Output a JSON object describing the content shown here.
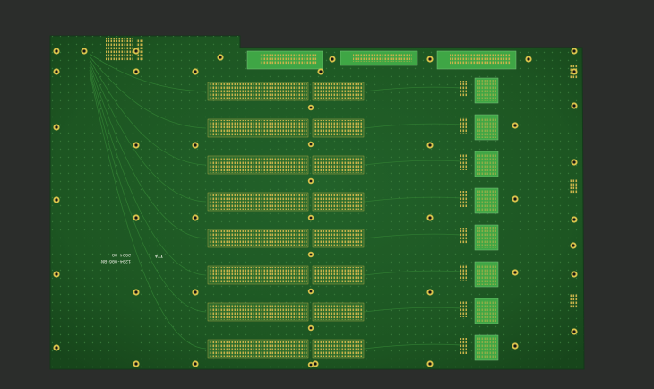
{
  "board": {
    "description_colors": {
      "background": "#2b2d2b",
      "solder_mask": "#1f5a23",
      "solder_mask_dark": "#184a1c",
      "copper_pad": "#c8b24a",
      "trace": "#2f7a31",
      "mounting_hole_ring": "#d9c24c",
      "silkscreen": "#e8ecdf",
      "green_connector": "#3fa645"
    },
    "silkscreen": {
      "line1": "1204-006-BN",
      "line2": "2024 08",
      "logo_mark": "IIA"
    },
    "slot_count": 8,
    "edge_connector_count": 3
  }
}
